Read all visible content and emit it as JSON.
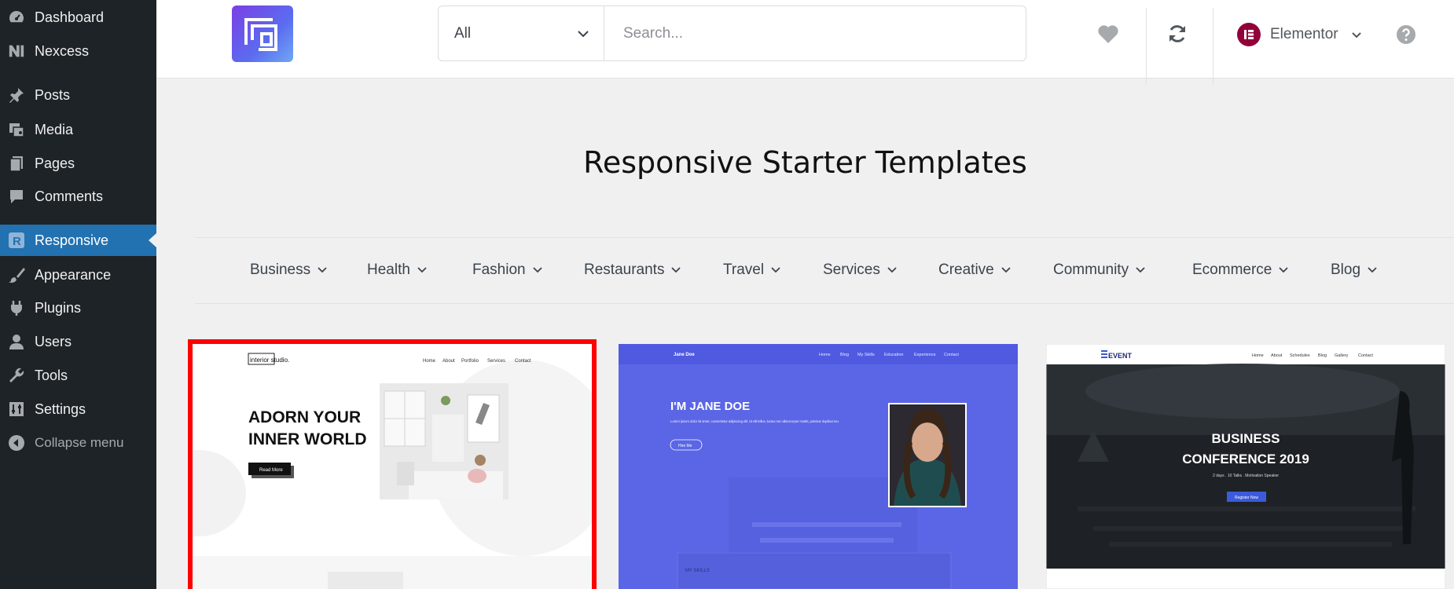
{
  "sidebar": {
    "items": [
      {
        "label": "Dashboard",
        "icon": "dashboard-icon"
      },
      {
        "label": "Nexcess",
        "icon": "nexcess-icon"
      },
      {
        "label": "Posts",
        "icon": "pin-icon"
      },
      {
        "label": "Media",
        "icon": "media-icon"
      },
      {
        "label": "Pages",
        "icon": "pages-icon"
      },
      {
        "label": "Comments",
        "icon": "comments-icon"
      },
      {
        "label": "Responsive",
        "icon": "responsive-icon",
        "active": true
      },
      {
        "label": "Appearance",
        "icon": "brush-icon"
      },
      {
        "label": "Plugins",
        "icon": "plugin-icon"
      },
      {
        "label": "Users",
        "icon": "user-icon"
      },
      {
        "label": "Tools",
        "icon": "wrench-icon"
      },
      {
        "label": "Settings",
        "icon": "settings-icon"
      },
      {
        "label": "Collapse menu",
        "icon": "collapse-icon"
      }
    ]
  },
  "header": {
    "filter_value": "All",
    "search_placeholder": "Search...",
    "builder_label": "Elementor",
    "accent_color": "#92003b"
  },
  "main": {
    "title": "Responsive Starter Templates",
    "categories": [
      "Business",
      "Health",
      "Fashion",
      "Restaurants",
      "Travel",
      "Services",
      "Creative",
      "Community",
      "Ecommerce",
      "Blog"
    ]
  },
  "templates": [
    {
      "logo": "interior studio.",
      "nav": [
        "Home",
        "About",
        "Portfolio",
        "Services",
        "Contact"
      ],
      "headline_1": "ADORN YOUR",
      "headline_2": "INNER WORLD",
      "button": "Read More",
      "selected": true
    },
    {
      "logo": "Jane Doe",
      "nav": [
        "Home",
        "Blog",
        "My Skills",
        "Education",
        "Experience",
        "Contact"
      ],
      "headline": "I'M JANE DOE",
      "body": "Lorem ipsum dolor sit amet, consectetur adipiscing elit. Ut elit tellus, luctus nec ullamcorper mattis, pulvinar dapibus leo.",
      "button": "Hire Me",
      "section": "MY SKILLS"
    },
    {
      "logo": "EVENT",
      "nav": [
        "Home",
        "About",
        "Schedules",
        "Blog",
        "Gallery",
        "Contact"
      ],
      "headline_1": "BUSINESS",
      "headline_2": "CONFERENCE 2019",
      "sub": "2 days . 10 Talks . Motivation Speaker",
      "button": "Register Now"
    }
  ]
}
